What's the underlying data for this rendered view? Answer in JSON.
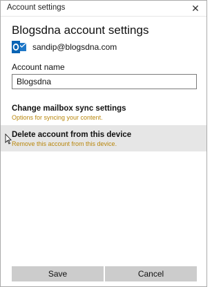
{
  "window": {
    "title": "Account settings",
    "close_glyph": "✕",
    "close_icon": "close-icon"
  },
  "header": {
    "title": "Blogsdna account settings"
  },
  "account": {
    "icon": "outlook-icon",
    "email": "sandip@blogsdna.com"
  },
  "account_name": {
    "label": "Account name",
    "value": "Blogsdna"
  },
  "settings": [
    {
      "title": "Change mailbox sync settings",
      "description": "Options for syncing your content."
    },
    {
      "title": "Delete account from this device",
      "description": "Remove this account from this device."
    }
  ],
  "buttons": {
    "save": "Save",
    "cancel": "Cancel"
  },
  "colors": {
    "description_text": "#b8860b",
    "hover_row": "#e6e6e6",
    "button_bg": "#cccccc",
    "outlook_blue": "#0a64b4"
  }
}
